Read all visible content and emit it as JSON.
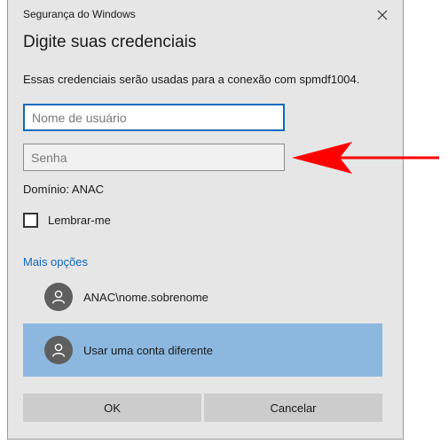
{
  "window": {
    "title": "Segurança do Windows",
    "close_icon": "close-icon"
  },
  "heading": "Digite suas credenciais",
  "description": "Essas credenciais serão usadas para a conexão com spmdf1004.",
  "username": {
    "value": "",
    "placeholder": "Nome de usuário"
  },
  "password": {
    "value": "",
    "placeholder": "Senha"
  },
  "domain": "Domínio: ANAC",
  "remember": {
    "label": "Lembrar-me",
    "checked": false
  },
  "more_options": "Mais opções",
  "accounts": [
    {
      "label": "ANAC\\nome.sobrenome",
      "icon": "user-avatar-icon",
      "selected": false
    },
    {
      "label": "Usar uma conta diferente",
      "icon": "user-avatar-icon",
      "selected": true
    }
  ],
  "buttons": {
    "ok": "OK",
    "cancel": "Cancelar"
  },
  "colors": {
    "dialog_bg": "#e6e6e6",
    "accent": "#0e6abf",
    "selected_row": "#8cb8e0",
    "button_bg": "#cccccc",
    "annotation_arrow": "#ff0000"
  }
}
